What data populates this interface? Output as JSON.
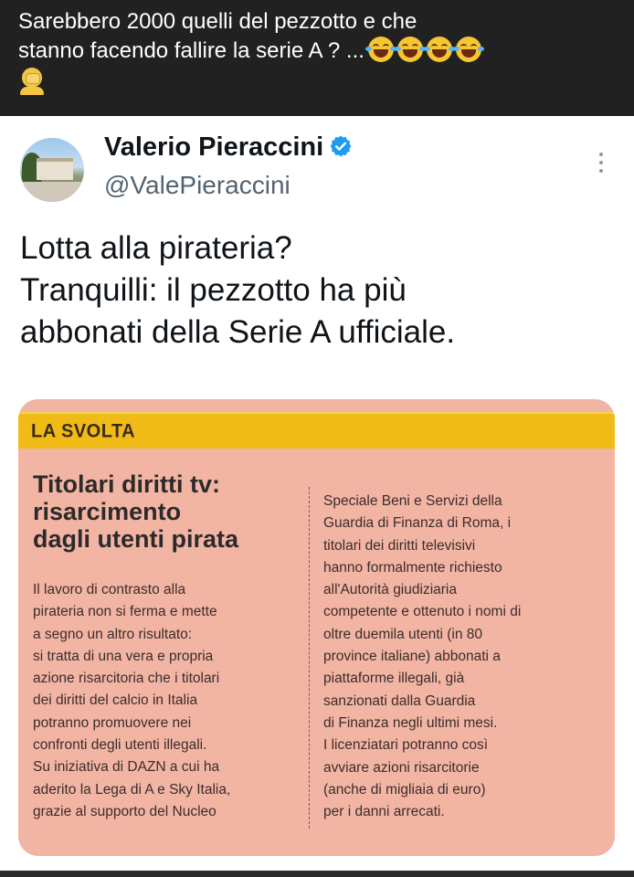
{
  "post": {
    "caption_line1": "Sarebbero 2000 quelli del pezzotto e che",
    "caption_line2": "stanno facendo fallire la serie A ? ...",
    "emojis": [
      "face-with-tears-of-joy",
      "face-with-tears-of-joy",
      "face-with-tears-of-joy",
      "face-with-tears-of-joy",
      "person-facepalming"
    ]
  },
  "tweet": {
    "author_name": "Valerio Pieraccini",
    "handle": "@ValePieraccini",
    "text_lines": [
      "Lotta alla pirateria?",
      "Tranquilli: il pezzotto ha più",
      "abbonati della Serie A ufficiale."
    ],
    "accent_color": "#1d9bf0"
  },
  "clipping": {
    "section_label": "LA SVOLTA",
    "headline_lines": [
      "Titolari diritti tv:",
      "risarcimento",
      "dagli utenti pirata"
    ],
    "left_column": [
      "Il lavoro di contrasto alla",
      "pirateria non si ferma e mette",
      "a segno un altro risultato:",
      "si tratta di una vera e propria",
      "azione risarcitoria che i titolari",
      "dei diritti del calcio in Italia",
      "potranno promuovere nei",
      "confronti degli utenti illegali.",
      "Su iniziativa di DAZN a cui ha",
      "aderito la Lega di A e Sky Italia,",
      "grazie al supporto del Nucleo"
    ],
    "right_column": [
      "Speciale Beni e Servizi della",
      "Guardia di Finanza di Roma, i",
      "titolari dei diritti televisivi",
      "hanno formalmente richiesto",
      "all'Autorità giudiziaria",
      "competente e ottenuto i nomi di",
      "oltre duemila utenti (in 80",
      "province italiane) abbonati a",
      "piattaforme illegali, già",
      "sanzionati dalla Guardia",
      "di Finanza negli ultimi mesi.",
      "I licenziatari potranno così",
      "avviare azioni risarcitorie",
      "(anche di migliaia di euro)",
      "per i danni arrecati."
    ],
    "colors": {
      "band": "#f1bb17",
      "paper": "#f2b5a3"
    }
  }
}
